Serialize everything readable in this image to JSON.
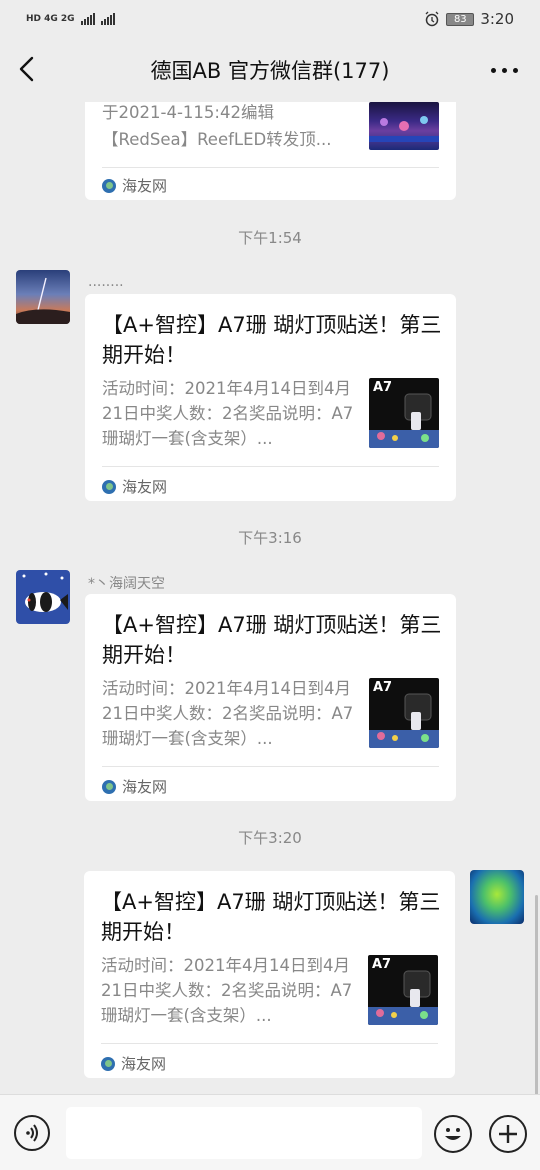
{
  "status_bar": {
    "left_text": "HD 4G 2G",
    "battery": "83",
    "time": "3:20"
  },
  "header": {
    "title": "德国AB  官方微信群(177)"
  },
  "messages": [
    {
      "partial_top": true,
      "title": "",
      "desc_line1": "于2021-4-115:42编辑",
      "desc_line2": "【RedSea】ReefLED转发顶...",
      "source": "海友网"
    },
    {
      "time": "下午1:54",
      "sender": "........",
      "title": "【A+智控】A7珊 瑚灯顶贴送！第三期开始！",
      "desc": "活动时间：2021年4月14日到4月21日中奖人数：2名奖品说明：A7珊瑚灯一套(含支架）...",
      "source": "海友网"
    },
    {
      "time": "下午3:16",
      "sender": "*丶海阔天空",
      "title": "【A+智控】A7珊 瑚灯顶贴送！第三期开始！",
      "desc": "活动时间：2021年4月14日到4月21日中奖人数：2名奖品说明：A7珊瑚灯一套(含支架）...",
      "source": "海友网"
    },
    {
      "time": "下午3:20",
      "sender": "",
      "title": "【A+智控】A7珊 瑚灯顶贴送！第三期开始！",
      "desc": "活动时间：2021年4月14日到4月21日中奖人数：2名奖品说明：A7珊瑚灯一套(含支架）...",
      "source": "海友网"
    }
  ],
  "thumb_label": "A7",
  "input": {
    "value": "",
    "voice_icon": "voice-icon",
    "emoji_icon": "emoji-icon",
    "plus_icon": "plus-icon"
  }
}
